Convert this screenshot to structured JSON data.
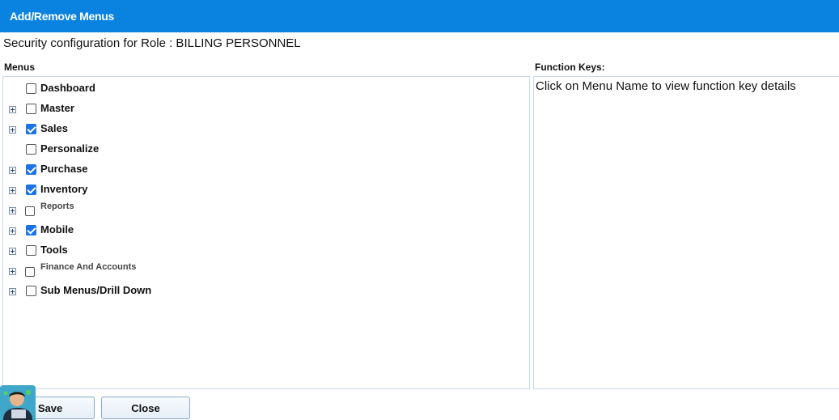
{
  "window": {
    "title": "Add/Remove Menus"
  },
  "role_line": "Security configuration for Role : BILLING PERSONNEL",
  "menus": {
    "label": "Menus",
    "items": [
      {
        "label": "Dashboard",
        "checked": false,
        "expandable": false,
        "small": false
      },
      {
        "label": "Master",
        "checked": false,
        "expandable": true,
        "small": false
      },
      {
        "label": "Sales",
        "checked": true,
        "expandable": true,
        "small": false
      },
      {
        "label": "Personalize",
        "checked": false,
        "expandable": false,
        "small": false
      },
      {
        "label": "Purchase",
        "checked": true,
        "expandable": true,
        "small": false
      },
      {
        "label": "Inventory",
        "checked": true,
        "expandable": true,
        "small": false
      },
      {
        "label": "Reports",
        "checked": false,
        "expandable": true,
        "small": true
      },
      {
        "label": "Mobile",
        "checked": true,
        "expandable": true,
        "small": false
      },
      {
        "label": "Tools",
        "checked": false,
        "expandable": true,
        "small": false
      },
      {
        "label": "Finance And Accounts",
        "checked": false,
        "expandable": true,
        "small": true
      },
      {
        "label": "Sub Menus/Drill Down",
        "checked": false,
        "expandable": true,
        "small": false
      }
    ]
  },
  "function_keys": {
    "label": "Function Keys:",
    "hint": "Click on Menu Name to view function key details"
  },
  "buttons": {
    "save": "Save",
    "close": "Close"
  },
  "colors": {
    "titlebar": "#0a82e0",
    "checkbox_checked": "#1a73e8",
    "panel_border": "#c9d9ea"
  },
  "icons": {
    "expander": "plus-square-icon",
    "avatar": "support-agent-icon"
  }
}
